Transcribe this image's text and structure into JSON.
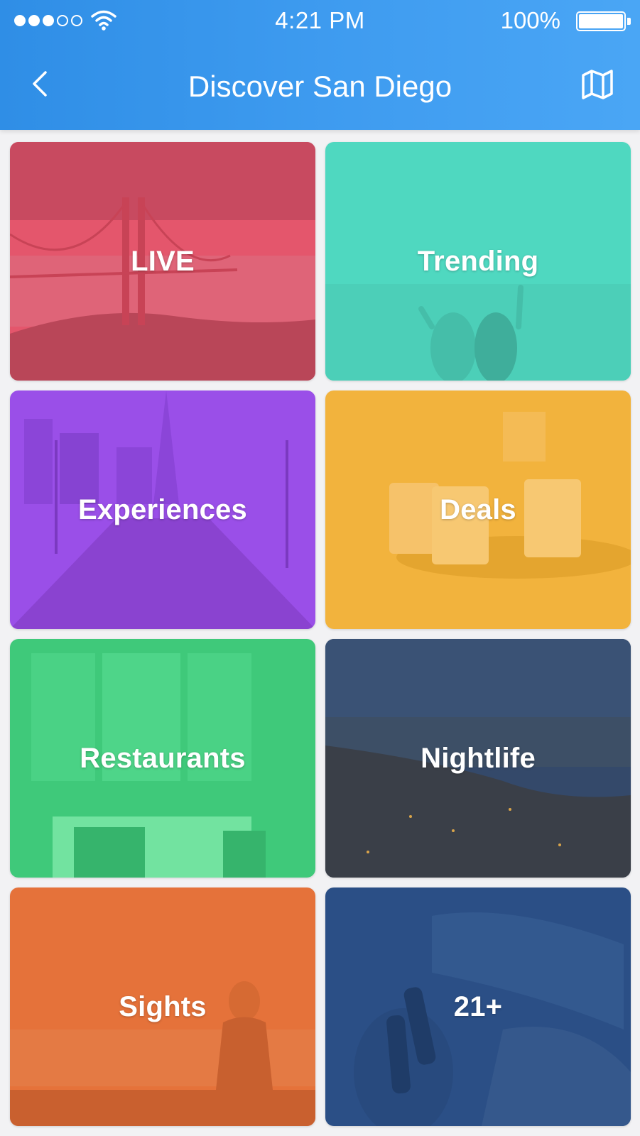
{
  "status_bar": {
    "time": "4:21 PM",
    "battery_percent": "100%",
    "signal_bars_filled": 3,
    "signal_bars_total": 5
  },
  "nav": {
    "title": "Discover San Diego",
    "back_icon": "chevron-left-icon",
    "map_icon": "map-icon"
  },
  "tiles": [
    {
      "label": "LIVE",
      "color": "#e4566c"
    },
    {
      "label": "Trending",
      "color": "#4fd8c0"
    },
    {
      "label": "Experiences",
      "color": "#9a4fe8"
    },
    {
      "label": "Deals",
      "color": "#f2b33d"
    },
    {
      "label": "Restaurants",
      "color": "#3fc97a"
    },
    {
      "label": "Nightlife",
      "color": "#34496a"
    },
    {
      "label": "Sights",
      "color": "#e5723a"
    },
    {
      "label": "21+",
      "color": "#2b4f86"
    }
  ],
  "colors": {
    "header_start": "#2f8ee6",
    "header_end": "#4aa6f5",
    "background": "#f2f2f4"
  }
}
